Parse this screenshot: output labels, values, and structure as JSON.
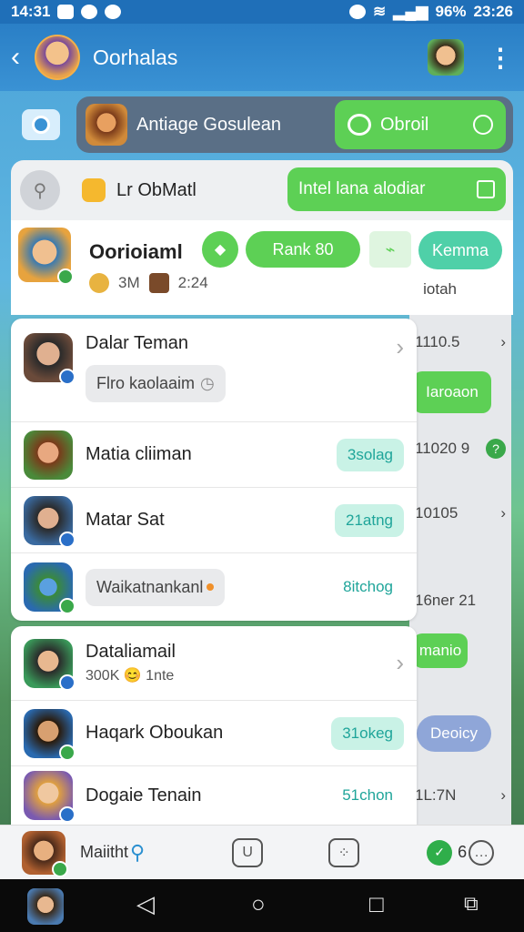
{
  "status_bar": {
    "time": "14:31",
    "battery": "96%",
    "clock_right": "23:26"
  },
  "header": {
    "title": "Oorhalas"
  },
  "game_card": {
    "title": "Antiage Gosulean",
    "button_label": "Obroil"
  },
  "panel": {
    "title": "Lr ObMatl",
    "online_button": "Intel lana alodiar"
  },
  "profile": {
    "name": "Oorioiaml",
    "stat1": "3M",
    "stat2": "2:24",
    "rank_label": "Rank 80",
    "kemma_label": "Kemma",
    "sub_label": "iotah"
  },
  "right_column": {
    "item1": "1110.5",
    "pill1": "Iaroaon",
    "item2": "11020 9",
    "item3": "10105",
    "item4": "16ner 21",
    "pill2": "manio",
    "pill3": "Deoicy",
    "item5": "1L:7N"
  },
  "list_top": {
    "section_title": "Dalar Teman",
    "pill_text": "Flro kaolaaim",
    "rows": [
      {
        "name": "Matia cliiman",
        "tag": "3solag"
      },
      {
        "name": "Matar Sat",
        "tag": "21atng"
      },
      {
        "name": "Waikatnankanl",
        "tag": "8itchog"
      }
    ]
  },
  "list_bottom": {
    "rows": [
      {
        "name": "Dataliamail",
        "sub": "300K 😊 1nte"
      },
      {
        "name": "Haqark Oboukan",
        "tag": "31okeg"
      },
      {
        "name": "Dogaie Tenain",
        "tag": "51chon"
      }
    ]
  },
  "app_nav": {
    "label": "Maiitht",
    "count": "6"
  }
}
